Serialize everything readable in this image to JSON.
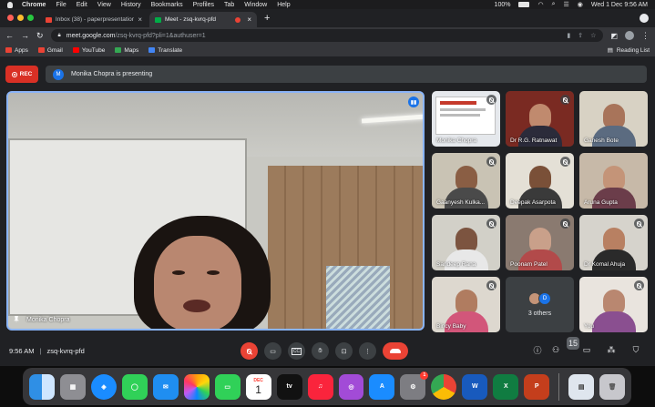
{
  "macos_menu": {
    "app": "Chrome",
    "items": [
      "File",
      "Edit",
      "View",
      "History",
      "Bookmarks",
      "Profiles",
      "Tab",
      "Window",
      "Help"
    ],
    "battery": "100%",
    "clock": "Wed 1 Dec  9:56 AM"
  },
  "browser": {
    "tabs": [
      {
        "title": "Inbox (38) - paperpresentation",
        "favicon": "gmail-icon",
        "active": false
      },
      {
        "title": "Meet - zsq-kvrq-pfd",
        "favicon": "meet-icon",
        "active": true
      }
    ],
    "url_host": "meet.google.com",
    "url_path": "/zsq-kvrq-pfd?pli=1&authuser=1",
    "bookmarks": [
      {
        "label": "Apps",
        "icon": "apps-grid-icon",
        "color": "#ea4335"
      },
      {
        "label": "Gmail",
        "icon": "gmail-icon",
        "color": "#ea4335"
      },
      {
        "label": "YouTube",
        "icon": "youtube-icon",
        "color": "#ff0000"
      },
      {
        "label": "Maps",
        "icon": "maps-icon",
        "color": "#34a853"
      },
      {
        "label": "Translate",
        "icon": "translate-icon",
        "color": "#4285f4"
      }
    ],
    "reading_list": "Reading List"
  },
  "meet": {
    "rec_label": "REC",
    "presenter_banner": "Monika Chopra is presenting",
    "presenter_initial": "M",
    "main_speaker": "Monika Chopra",
    "participants": [
      {
        "name": "Monika Chopra",
        "muted": true,
        "bg": "#dfe4ea",
        "skin": "#7a5a44"
      },
      {
        "name": "Dr R.G. Ratnawat",
        "muted": true,
        "bg": "#7a2a22",
        "skin": "#c08a6e"
      },
      {
        "name": "Ganesh Bote",
        "muted": false,
        "bg": "#d8d2c4",
        "skin": "#a8745a"
      },
      {
        "name": "Gaanyesh Kulka...",
        "muted": true,
        "bg": "#c9c3b4",
        "skin": "#8a5e44"
      },
      {
        "name": "Deepak Asarpota",
        "muted": true,
        "bg": "#e4e0d6",
        "skin": "#7a5038"
      },
      {
        "name": "Aruna Gupta",
        "muted": false,
        "bg": "#c7b9a8",
        "skin": "#c49478"
      },
      {
        "name": "Sandeep Rana",
        "muted": true,
        "bg": "#d2d0c8",
        "skin": "#7c5440"
      },
      {
        "name": "Poonam Patel",
        "muted": true,
        "bg": "#8a7a70",
        "skin": "#c9a08a"
      },
      {
        "name": "Dr Komal Ahuja",
        "muted": true,
        "bg": "#d6d3cc",
        "skin": "#b88062"
      },
      {
        "name": "Bincy Baby",
        "muted": true,
        "bg": "#ddd8cf",
        "skin": "#b07c60"
      },
      {
        "name": "3 others",
        "muted": false,
        "bg": "#3c4043",
        "skin": "#3c4043"
      },
      {
        "name": "You",
        "muted": false,
        "bg": "#e9e4de",
        "skin": "#b98770"
      }
    ],
    "others_initial": "D",
    "meeting_time": "9:56 AM",
    "meeting_code": "zsq-kvrq-pfd",
    "people_count": "15"
  },
  "dock": {
    "calendar_month": "DEC",
    "calendar_day": "1",
    "appstore_badge": "1",
    "apps": [
      "Finder",
      "Launchpad",
      "Safari",
      "Messages",
      "Mail",
      "Photos",
      "FaceTime",
      "Calendar",
      "Apple TV",
      "Music",
      "Podcasts",
      "App Store",
      "System Preferences",
      "Chrome",
      "Word",
      "Excel",
      "PowerPoint",
      "Preview",
      "Trash"
    ]
  }
}
